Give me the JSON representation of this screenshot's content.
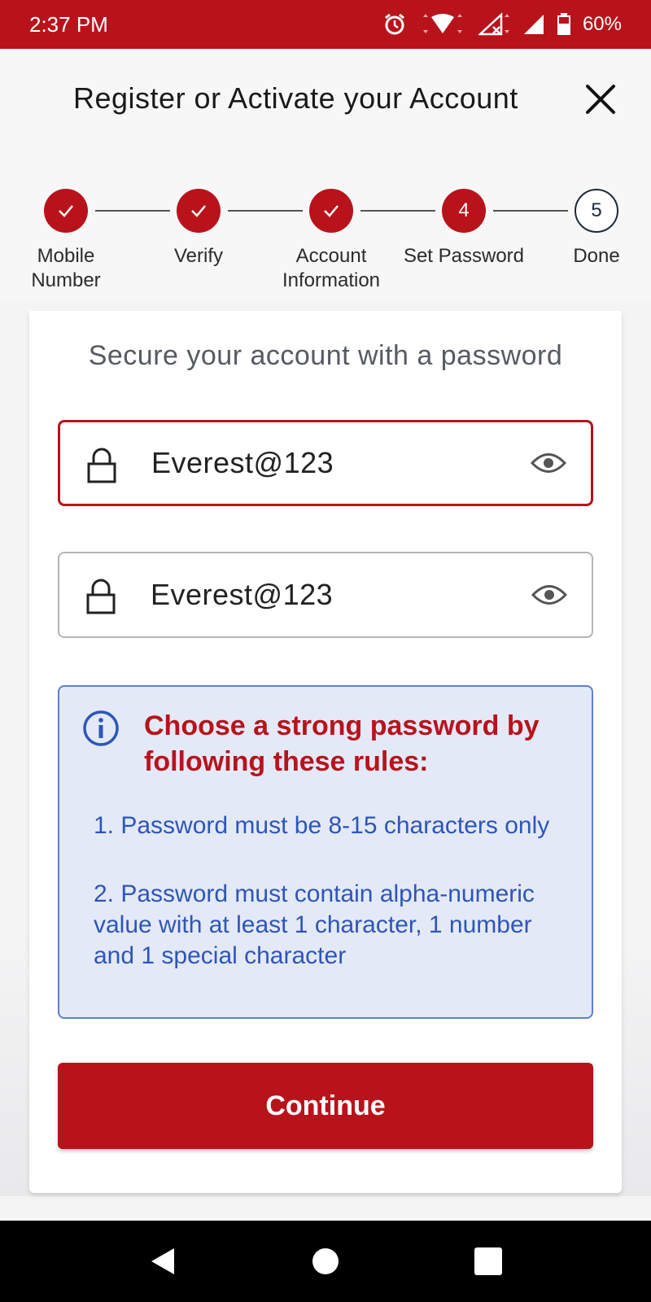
{
  "status_bar": {
    "time": "2:37 PM",
    "battery": "60%",
    "icons": [
      "alarm-icon",
      "wifi-icon",
      "signal-x-icon",
      "signal-icon",
      "battery-icon"
    ]
  },
  "header": {
    "title": "Register or Activate your Account",
    "close_icon": "close-icon"
  },
  "stepper": {
    "steps": [
      {
        "label_line1": "Mobile",
        "label_line2": "Number",
        "state": "done",
        "number": ""
      },
      {
        "label_line1": "Verify",
        "label_line2": "",
        "state": "done",
        "number": ""
      },
      {
        "label_line1": "Account",
        "label_line2": "Information",
        "state": "done",
        "number": ""
      },
      {
        "label_line1": "Set Password",
        "label_line2": "",
        "state": "active",
        "number": "4"
      },
      {
        "label_line1": "Done",
        "label_line2": "",
        "state": "todo",
        "number": "5"
      }
    ]
  },
  "card": {
    "heading": "Secure your account with a password",
    "password": {
      "value": "Everest@123"
    },
    "confirm_password": {
      "value": "Everest@123"
    },
    "info": {
      "title": "Choose a strong password by following these rules:",
      "rules": [
        "1. Password must be 8-15 characters only",
        "2.  Password must contain alpha-numeric value with at least 1 character, 1 number and 1 special character"
      ]
    },
    "continue_label": "Continue"
  },
  "colors": {
    "brand_red": "#b8131b",
    "info_blue": "#2e56b8",
    "info_bg": "#e4e9f8"
  }
}
